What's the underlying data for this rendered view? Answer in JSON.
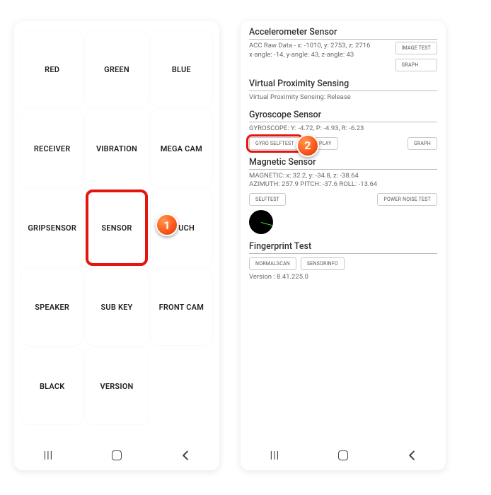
{
  "left": {
    "tiles": [
      "RED",
      "GREEN",
      "BLUE",
      "RECEIVER",
      "VIBRATION",
      "MEGA CAM",
      "GRIPSENSOR",
      "SENSOR",
      "TOUCH",
      "SPEAKER",
      "SUB KEY",
      "FRONT CAM",
      "BLACK",
      "VERSION"
    ],
    "highlight_index": 7,
    "badge1": "1"
  },
  "right": {
    "accel": {
      "title": "Accelerometer Sensor",
      "line1": "ACC Raw Data - x: -1010, y: 2753, z: 2716",
      "line2": "x-angle: -14, y-angle: 43, z-angle: 43",
      "btn_image": "IMAGE TEST",
      "btn_graph": "GRAPH"
    },
    "vps": {
      "title": "Virtual Proximity Sensing",
      "line1": "Virtual Proximity Sensing: Release"
    },
    "gyro": {
      "title": "Gyroscope Sensor",
      "line1": "GYROSCOPE: Y: -4.72, P: -4.93, R: -6.23",
      "btn_self": "GYRO SELFTEST",
      "btn_display": "DISPLAY",
      "btn_graph": "GRAPH"
    },
    "mag": {
      "title": "Magnetic Sensor",
      "line1": "MAGNETIC: x: 32.2, y: -34.8, z: -38.64",
      "line2": "AZIMUTH: 257.9   PITCH: -37.6   ROLL: -13.64",
      "btn_self": "SELFTEST",
      "btn_noise": "POWER NOISE TEST"
    },
    "fp": {
      "title": "Fingerprint Test",
      "btn_scan": "NORMALSCAN",
      "btn_info": "SENSORINFO",
      "version": "Version : 8.41.225.0"
    },
    "badge2": "2"
  }
}
